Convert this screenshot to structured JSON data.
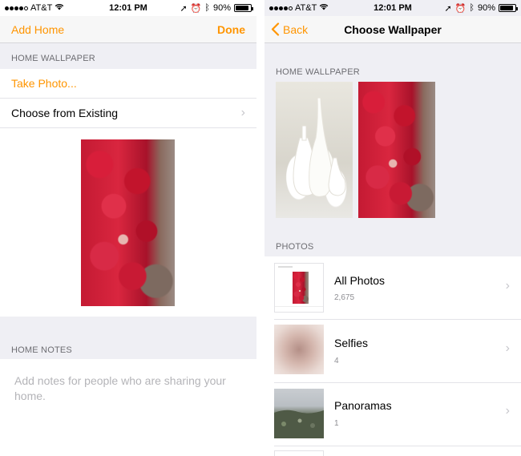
{
  "status": {
    "carrier": "AT&T",
    "time": "12:01 PM",
    "battery": "90%"
  },
  "left": {
    "nav": {
      "left_button": "Add Home",
      "right_button": "Done"
    },
    "section_wallpaper": "HOME WALLPAPER",
    "take_photo": "Take Photo...",
    "choose_existing": "Choose from Existing",
    "section_notes": "HOME NOTES",
    "notes_placeholder": "Add notes for people who are sharing your home."
  },
  "right": {
    "nav": {
      "back": "Back",
      "title": "Choose Wallpaper"
    },
    "section_wallpaper": "HOME WALLPAPER",
    "section_photos": "PHOTOS",
    "albums": [
      {
        "title": "All Photos",
        "count": "2,675"
      },
      {
        "title": "Selfies",
        "count": "4"
      },
      {
        "title": "Panoramas",
        "count": "1"
      }
    ]
  },
  "colors": {
    "accent": "#ff9500",
    "group_bg": "#efeff4",
    "chevron": "#c7c7cc"
  }
}
